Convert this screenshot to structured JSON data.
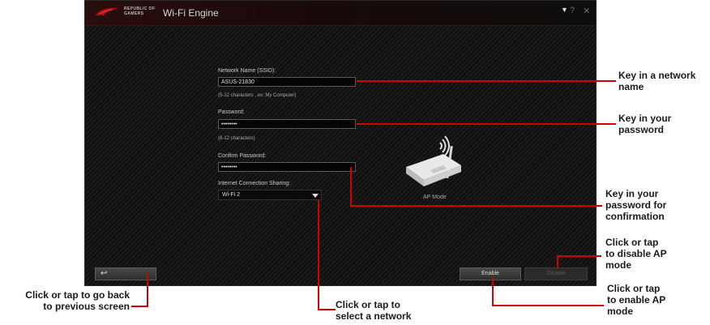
{
  "window": {
    "brand_line1": "REPUBLIC OF",
    "brand_line2": "GAMERS",
    "title": "Wi-Fi Engine",
    "controls": [
      "▼",
      "?",
      "✕"
    ]
  },
  "form": {
    "ssid_label": "Network Name (SSID):",
    "ssid_value": "ASUS-21830",
    "ssid_hint": "(5-12 characters , ex: My Computer)",
    "password_label": "Password:",
    "password_value": "••••••••",
    "password_hint": "(8-12 characters)",
    "confirm_label": "Confirm Password:",
    "confirm_value": "••••••••",
    "sharing_label": "Internet Connection Sharing:",
    "sharing_value": "Wi-Fi 2"
  },
  "ap": {
    "label": "AP Mode"
  },
  "buttons": {
    "back": "↩",
    "enable": "Enable",
    "disable": "Disable"
  },
  "callouts": {
    "network_name": "Key in a network\nname",
    "password": "Key in your\npassword",
    "confirm": "Key in your\npassword for\nconfirmation",
    "disable": "Click or tap\nto disable AP\nmode",
    "enable": "Click or tap\nto enable AP\nmode",
    "back": "Click or tap to go back\nto previous screen",
    "select": "Click or tap to\nselect a network"
  },
  "colors": {
    "accent": "#d40000",
    "window_bg": "#141414"
  }
}
